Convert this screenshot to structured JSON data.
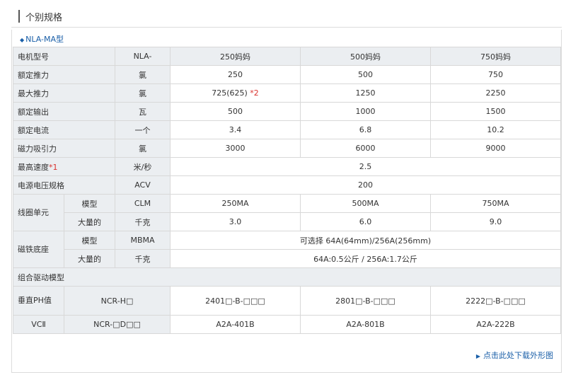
{
  "section_title": "个别规格",
  "model_tag": "NLA-MA型",
  "header": {
    "label": "电机型号",
    "unit": "NLA-",
    "cols": [
      "250妈妈",
      "500妈妈",
      "750妈妈"
    ]
  },
  "rows": [
    {
      "label": "额定推力",
      "unit": "氯",
      "values": [
        "250",
        "500",
        "750"
      ]
    },
    {
      "label": "最大推力",
      "unit": "氯",
      "values": [
        "725(625)",
        "1250",
        "2250"
      ],
      "note": "*2"
    },
    {
      "label": "额定输出",
      "unit": "瓦",
      "values": [
        "500",
        "1000",
        "1500"
      ]
    },
    {
      "label": "额定电流",
      "unit": "一个",
      "values": [
        "3.4",
        "6.8",
        "10.2"
      ]
    },
    {
      "label": "磁力吸引力",
      "unit": "氯",
      "values": [
        "3000",
        "6000",
        "9000"
      ]
    }
  ],
  "max_speed": {
    "label": "最高速度",
    "note": "*1",
    "unit": "米/秒",
    "value": "2.5"
  },
  "power": {
    "label": "电源电压规格",
    "unit": "ACV",
    "value": "200"
  },
  "coil": {
    "group": "线圈单元",
    "model": {
      "label": "模型",
      "unit": "CLM",
      "values": [
        "250MA",
        "500MA",
        "750MA"
      ]
    },
    "mass": {
      "label": "大量的",
      "unit": "千克",
      "values": [
        "3.0",
        "6.0",
        "9.0"
      ]
    }
  },
  "magnet": {
    "group": "磁铁底座",
    "model": {
      "label": "模型",
      "unit": "MBMA",
      "value": "可选择 64A(64mm)/256A(256mm)"
    },
    "mass": {
      "label": "大量的",
      "unit": "千克",
      "value": "64A:0.5公斤 / 256A:1.7公斤"
    }
  },
  "combo_title": "组合驱动模型",
  "combo": [
    {
      "label": "垂直PH值",
      "model": "NCR-H□",
      "values": [
        "2401□-B-□□□",
        "2801□-B-□□□",
        "2222□-B-□□□"
      ]
    },
    {
      "label": "VCⅡ",
      "model": "NCR-□D□□",
      "values": [
        "A2A-401B",
        "A2A-801B",
        "A2A-222B"
      ]
    }
  ],
  "footer_link": "点击此处下载外形图"
}
